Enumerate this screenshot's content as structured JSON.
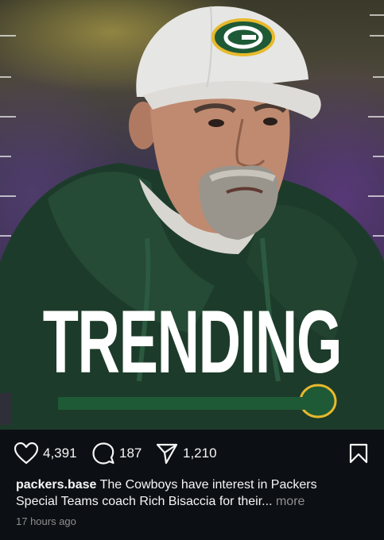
{
  "post": {
    "headline": "TRENDING",
    "image_alt": "Coach in white Packers cap and green hoodie"
  },
  "actions": {
    "likes": "4,391",
    "comments": "187",
    "shares": "1,210"
  },
  "caption": {
    "username": "packers.base",
    "line1": "The Cowboys have interest in Packers",
    "line2": "Special Teams coach Rich Bisaccia for their...",
    "more_label": "more"
  },
  "timestamp": "17 hours ago",
  "colors": {
    "background": "#0c1014",
    "packers_green": "#1f5a37",
    "muted_text": "#8e8e8e"
  },
  "icons": {
    "like": "heart-icon",
    "comment": "comment-icon",
    "share": "send-icon",
    "save": "bookmark-icon"
  }
}
